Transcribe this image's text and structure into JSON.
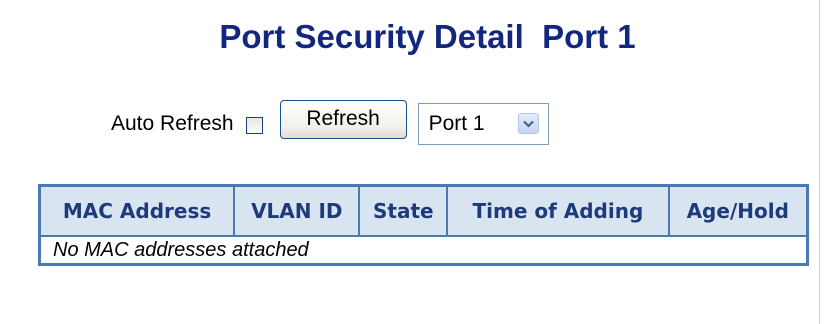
{
  "page": {
    "title": "Port Security Detail  Port 1"
  },
  "controls": {
    "auto_refresh_label": "Auto Refresh",
    "auto_refresh_checked": false,
    "refresh_button_label": "Refresh",
    "port_select_value": "Port 1"
  },
  "table": {
    "headers": [
      "MAC Address",
      "VLAN ID",
      "State",
      "Time of Adding",
      "Age/Hold"
    ],
    "empty_message": "No MAC addresses attached"
  },
  "colors": {
    "title": "#13277f",
    "header_bg": "#d9e4f1",
    "header_text": "#1d3a7a",
    "table_border": "#4a78b3"
  }
}
